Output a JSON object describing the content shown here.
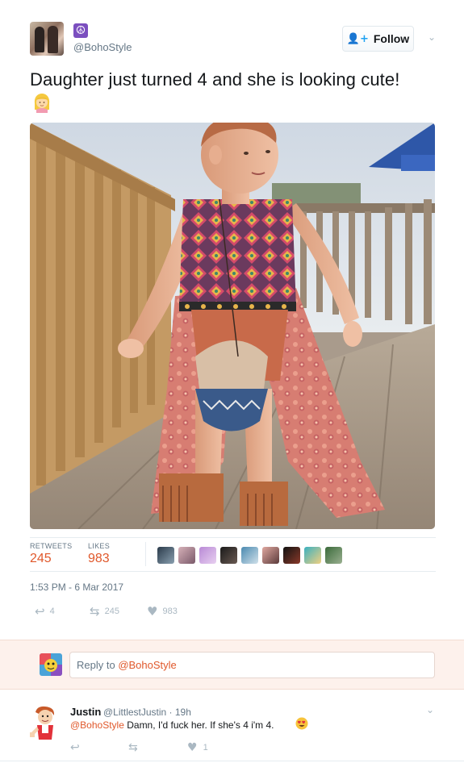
{
  "tweet": {
    "handle": "@BohoStyle",
    "name_badge": "☮",
    "follow_label": "Follow",
    "text": "Daughter just turned 4 and she is looking cute!",
    "emoji": "person-blond-hair-emoji",
    "image_alt_icon": "photo-child-boho-dress"
  },
  "stats": {
    "retweets_label": "RETWEETS",
    "retweets_value": "245",
    "likes_label": "LIKES",
    "likes_value": "983"
  },
  "timestamp": "1:53 PM - 6 Mar 2017",
  "actions": {
    "reply_count": "4",
    "retweet_count": "245",
    "like_count": "983"
  },
  "reply_box": {
    "prefix": "Reply to ",
    "mention": "@BohoStyle"
  },
  "comment": {
    "name": "Justin",
    "handle": "@LittlestJustin · 19h",
    "mention": "@BohoStyle",
    "text": " Damn, I'd fuck her. If she's 4 i'm 4.",
    "emoji": "heart-eyes-emoji",
    "like_count": "1"
  },
  "colors": {
    "accent": "#e0582b",
    "link_blue": "#1da1f2",
    "muted": "#657786",
    "icon_gray": "#aab8c2",
    "reply_band": "#fdf1ec"
  }
}
